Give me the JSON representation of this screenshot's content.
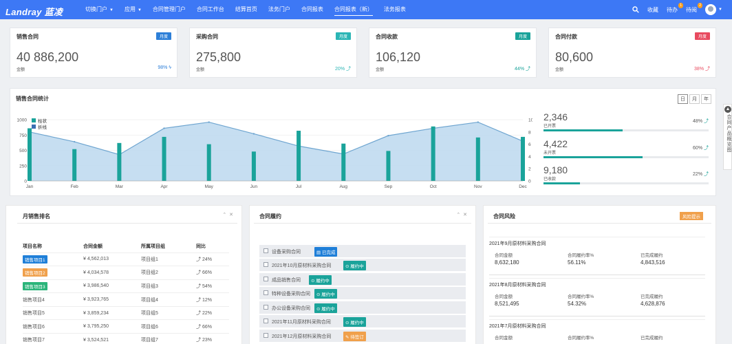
{
  "nav": {
    "logo": "Landray 蓝凌",
    "menu": [
      {
        "label": "切换门户",
        "caret": true
      },
      {
        "label": "应用",
        "caret": true
      },
      {
        "label": "合同管理门户"
      },
      {
        "label": "合同工作台"
      },
      {
        "label": "结算首页"
      },
      {
        "label": "法务门户"
      },
      {
        "label": "合同报表"
      },
      {
        "label": "合同报表（新）",
        "active": true
      },
      {
        "label": "法务报表"
      }
    ],
    "favorites": "收藏",
    "todo": "待办",
    "todo_count": "1",
    "toread": "待阅",
    "toread_count": "2"
  },
  "kpis": [
    {
      "title": "销售合同",
      "tag": "月度",
      "tag_color": "#2d7fd8",
      "value": "40 886,200",
      "sub": "金额",
      "pct": "98%",
      "pct_color": "#2d7fd8"
    },
    {
      "title": "采购合同",
      "tag": "月度",
      "tag_color": "#2bb5b5",
      "value": "275,800",
      "sub": "金额",
      "pct": "20%",
      "pct_color": "#2bb5b5"
    },
    {
      "title": "合同收款",
      "tag": "月度",
      "tag_color": "#1aa39a",
      "value": "106,120",
      "sub": "金额",
      "pct": "44%",
      "pct_color": "#1aa39a"
    },
    {
      "title": "合同付款",
      "tag": "月度",
      "tag_color": "#e84a5f",
      "value": "80,600",
      "sub": "金额",
      "pct": "38%",
      "pct_color": "#e84a5f"
    }
  ],
  "stats": {
    "title": "销售合同统计",
    "range": [
      "日",
      "月",
      "年"
    ],
    "side": [
      {
        "value": "2,346",
        "label": "已开票",
        "pct": "48%",
        "fill": 0.48
      },
      {
        "value": "4,422",
        "label": "未开票",
        "pct": "60%",
        "fill": 0.6
      },
      {
        "value": "9,180",
        "label": "已收款",
        "pct": "22%",
        "fill": 0.22
      }
    ]
  },
  "chart_data": {
    "type": "bar",
    "categories": [
      "Jan",
      "Feb",
      "Mar",
      "Apr",
      "May",
      "Jun",
      "Jul",
      "Aug",
      "Sep",
      "Oct",
      "Nov",
      "Dec"
    ],
    "series": [
      {
        "name": "柱状",
        "kind": "bar",
        "axis": "right",
        "color": "#1aa39a",
        "values": [
          8.6,
          5.2,
          6.2,
          7.2,
          6.0,
          4.8,
          8.2,
          6.1,
          4.9,
          8.9,
          7.1,
          7.2
        ]
      },
      {
        "name": "折线",
        "kind": "area",
        "axis": "left",
        "color": "#6ea5d0",
        "values": [
          800,
          640,
          430,
          860,
          960,
          770,
          570,
          440,
          740,
          860,
          960,
          650
        ]
      }
    ],
    "y_left": {
      "ticks": [
        0,
        250,
        500,
        750,
        1000
      ],
      "range": [
        0,
        1000
      ]
    },
    "y_right": {
      "ticks": [
        0,
        2,
        4,
        6,
        8,
        10
      ],
      "range": [
        0,
        10
      ]
    },
    "legend": "top-left",
    "grid": true
  },
  "ranking": {
    "title": "月销售排名",
    "headers": [
      "项目名称",
      "合同金额",
      "所属项目组",
      "同比"
    ],
    "rows": [
      {
        "name": "销售项目1",
        "tag": "#1f7fd8",
        "amount": "¥ 4,562,013",
        "group": "项目组1",
        "yoy": "24%"
      },
      {
        "name": "销售项目2",
        "tag": "#f0a04b",
        "amount": "¥ 4,034,578",
        "group": "项目组2",
        "yoy": "66%"
      },
      {
        "name": "销售项目3",
        "tag": "#2bb57a",
        "amount": "¥ 3,986,540",
        "group": "项目组3",
        "yoy": "54%"
      },
      {
        "name": "销售项目4",
        "tag": "",
        "amount": "¥ 3,923,765",
        "group": "项目组4",
        "yoy": "12%"
      },
      {
        "name": "销售项目5",
        "tag": "",
        "amount": "¥ 3,859,234",
        "group": "项目组5",
        "yoy": "22%"
      },
      {
        "name": "销售项目6",
        "tag": "",
        "amount": "¥ 3,795,250",
        "group": "项目组6",
        "yoy": "66%"
      },
      {
        "name": "销售项目7",
        "tag": "",
        "amount": "¥ 3,524,521",
        "group": "项目组7",
        "yoy": "23%"
      }
    ]
  },
  "fulfillment": {
    "title": "合同履约",
    "items": [
      {
        "name": "设备采购合同",
        "status": "已完成",
        "color": "#1f7fd8"
      },
      {
        "name": "2021年10月原材料采购合同",
        "status": "履约中",
        "color": "#1aa39a"
      },
      {
        "name": "成品销售合同",
        "status": "履约中",
        "color": "#1aa39a"
      },
      {
        "name": "特种设备采购合同",
        "status": "履约中",
        "color": "#1aa39a"
      },
      {
        "name": "办公设备采购合同",
        "status": "履约中",
        "color": "#1aa39a"
      },
      {
        "name": "2021年11月原材料采购合同",
        "status": "履约中",
        "color": "#1aa39a"
      },
      {
        "name": "2021年12月原材料采购合同",
        "status": "待签订",
        "color": "#f0a04b"
      }
    ]
  },
  "risk": {
    "title": "合同风险",
    "tag": "风险提示",
    "items": [
      {
        "title": "2021年9月原材料采购合同",
        "labels": [
          "合同金额",
          "合同履约率%",
          "已完成履约"
        ],
        "values": [
          "8,632,180",
          "56.11%",
          "4,843,516"
        ]
      },
      {
        "title": "2021年8月原材料采购合同",
        "labels": [
          "合同金额",
          "合同履约率%",
          "已完成履约"
        ],
        "values": [
          "8,521,495",
          "54.32%",
          "4,628,876"
        ]
      },
      {
        "title": "2021年7月原材料采购合同",
        "labels": [
          "合同金额",
          "合同履约率%",
          "已完成履约"
        ],
        "values": [
          "",
          "",
          ""
        ]
      }
    ]
  },
  "sidebar_float": {
    "label": "合同产品概览图"
  }
}
